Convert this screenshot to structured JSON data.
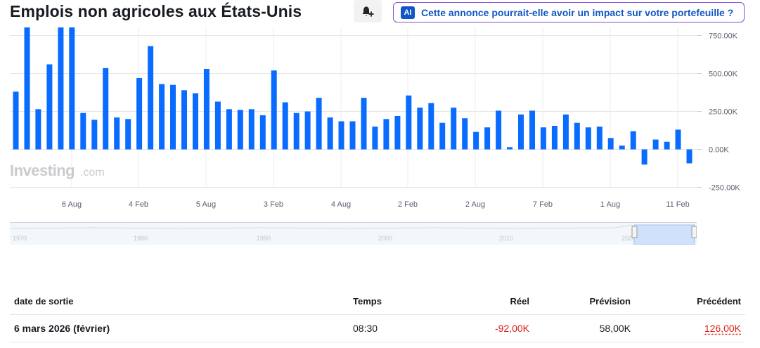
{
  "header": {
    "title": "Emplois non agricoles aux États-Unis",
    "ai_badge": "AI",
    "ai_prompt": "Cette annonce pourrait-elle avoir un impact sur votre portefeuille ?"
  },
  "watermark": {
    "main": "Investing",
    "suffix": ".com"
  },
  "colors": {
    "bar": "#0a6cff",
    "negative": "#d91e18",
    "ai_border": "#8a4fd8",
    "ai_text": "#1256c4"
  },
  "icons": {
    "alert": "bell-plus-icon",
    "ai": "ai-badge-icon"
  },
  "chart_data": {
    "type": "bar",
    "y_ticks": [
      "750.00K",
      "500.00K",
      "250.00K",
      "0.00K",
      "-250.00K"
    ],
    "x_ticks": [
      "6 Aug",
      "4 Feb",
      "5 Aug",
      "3 Feb",
      "4 Aug",
      "2 Feb",
      "2 Aug",
      "7 Feb",
      "1 Aug",
      "11 Feb"
    ],
    "ylim": [
      -250,
      800
    ],
    "y_unit": "K",
    "grid": true,
    "values": [
      380,
      820,
      265,
      560,
      820,
      820,
      240,
      195,
      535,
      210,
      200,
      470,
      680,
      430,
      425,
      390,
      370,
      530,
      315,
      265,
      260,
      265,
      225,
      520,
      310,
      240,
      250,
      340,
      210,
      185,
      185,
      340,
      150,
      200,
      220,
      355,
      275,
      305,
      175,
      275,
      205,
      115,
      145,
      255,
      15,
      230,
      255,
      145,
      155,
      230,
      175,
      145,
      150,
      75,
      25,
      120,
      -100,
      65,
      50,
      130,
      -92
    ]
  },
  "navigator": {
    "years": [
      "1970",
      "1980",
      "1990",
      "2000",
      "2010",
      "2020"
    ]
  },
  "table": {
    "headers": {
      "date": "date de sortie",
      "time": "Temps",
      "actual": "Réel",
      "forecast": "Prévision",
      "previous": "Précédent"
    },
    "rows": [
      {
        "date": "6 mars 2026 (février)",
        "time": "08:30",
        "actual": "-92,00K",
        "forecast": "58,00K",
        "previous": "126,00K"
      }
    ]
  }
}
